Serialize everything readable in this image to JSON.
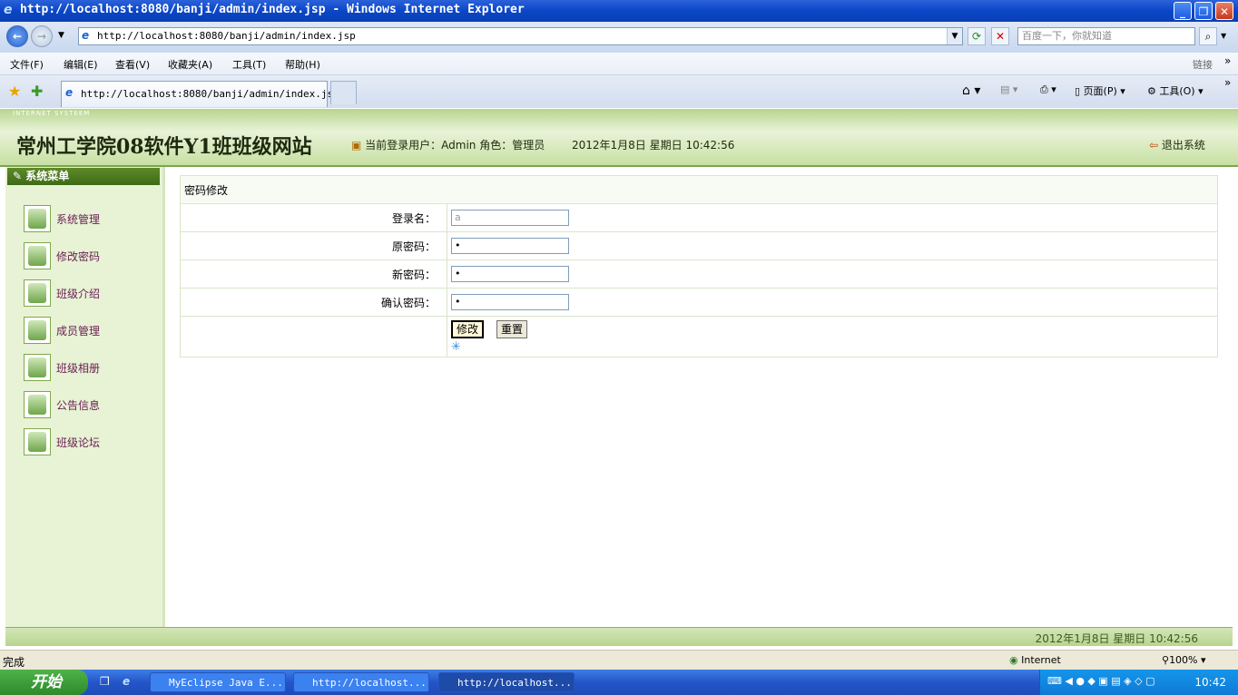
{
  "window": {
    "title": "http://localhost:8080/banji/admin/index.jsp - Windows Internet Explorer",
    "address": "http://localhost:8080/banji/admin/index.jsp",
    "search_placeholder": "百度一下，你就知道"
  },
  "menubar": {
    "items": [
      "文件(F)",
      "编辑(E)",
      "查看(V)",
      "收藏夹(A)",
      "工具(T)",
      "帮助(H)"
    ],
    "links": "链接"
  },
  "tab": {
    "active_title": "http://localhost:8080/banji/admin/index.jsp"
  },
  "toolbar": {
    "page": "页面(P)",
    "tools": "工具(O)"
  },
  "header": {
    "brand_strip": "INTERNET SYSTEEM",
    "site_title": "常州工学院08软件Y1班班级网站",
    "user_info": "当前登录用户：Admin 角色：管理员",
    "datetime": "2012年1月8日  星期日  10:42:56",
    "logout": "退出系统"
  },
  "sidebar": {
    "title": "系统菜单",
    "items": [
      {
        "label": "系统管理"
      },
      {
        "label": "修改密码"
      },
      {
        "label": "班级介绍"
      },
      {
        "label": "成员管理"
      },
      {
        "label": "班级相册"
      },
      {
        "label": "公告信息"
      },
      {
        "label": "班级论坛"
      }
    ]
  },
  "form": {
    "caption": "密码修改",
    "login_name_label": "登录名：",
    "login_name_value": "a",
    "old_password_label": "原密码：",
    "old_password_value": "•",
    "new_password_label": "新密码：",
    "new_password_value": "•",
    "confirm_password_label": "确认密码：",
    "confirm_password_value": "•",
    "submit_label": "修改",
    "reset_label": "重置"
  },
  "footer": {
    "datetime": "2012年1月8日  星期日  10:42:56"
  },
  "statusbar": {
    "status": "完成",
    "zone": "Internet",
    "zoom": "100%"
  },
  "taskbar": {
    "start": "开始",
    "buttons": [
      {
        "label": "MyEclipse Java E..."
      },
      {
        "label": "http://localhost..."
      },
      {
        "label": "http://localhost..."
      }
    ],
    "clock": "10:42"
  }
}
